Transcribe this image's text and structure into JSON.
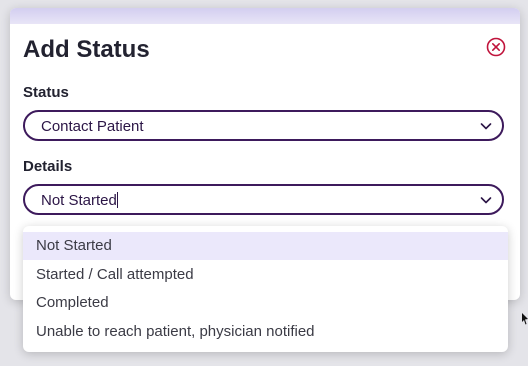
{
  "modal": {
    "title": "Add Status"
  },
  "status_field": {
    "label": "Status",
    "value": "Contact Patient"
  },
  "details_field": {
    "label": "Details",
    "value": "Not Started"
  },
  "dropdown": {
    "options": [
      {
        "label": "Not Started",
        "selected": true
      },
      {
        "label": "Started / Call attempted",
        "selected": false
      },
      {
        "label": "Completed",
        "selected": false
      },
      {
        "label": "Unable to reach patient, physician notified",
        "selected": false
      }
    ]
  },
  "colors": {
    "accent": "#3d1a5c",
    "close_icon": "#c0143c",
    "selected_option_bg": "#ebe8fb",
    "header_band": "#d3cef0"
  },
  "icons": {
    "close": "close-circle-icon",
    "chevron": "chevron-down-icon"
  }
}
